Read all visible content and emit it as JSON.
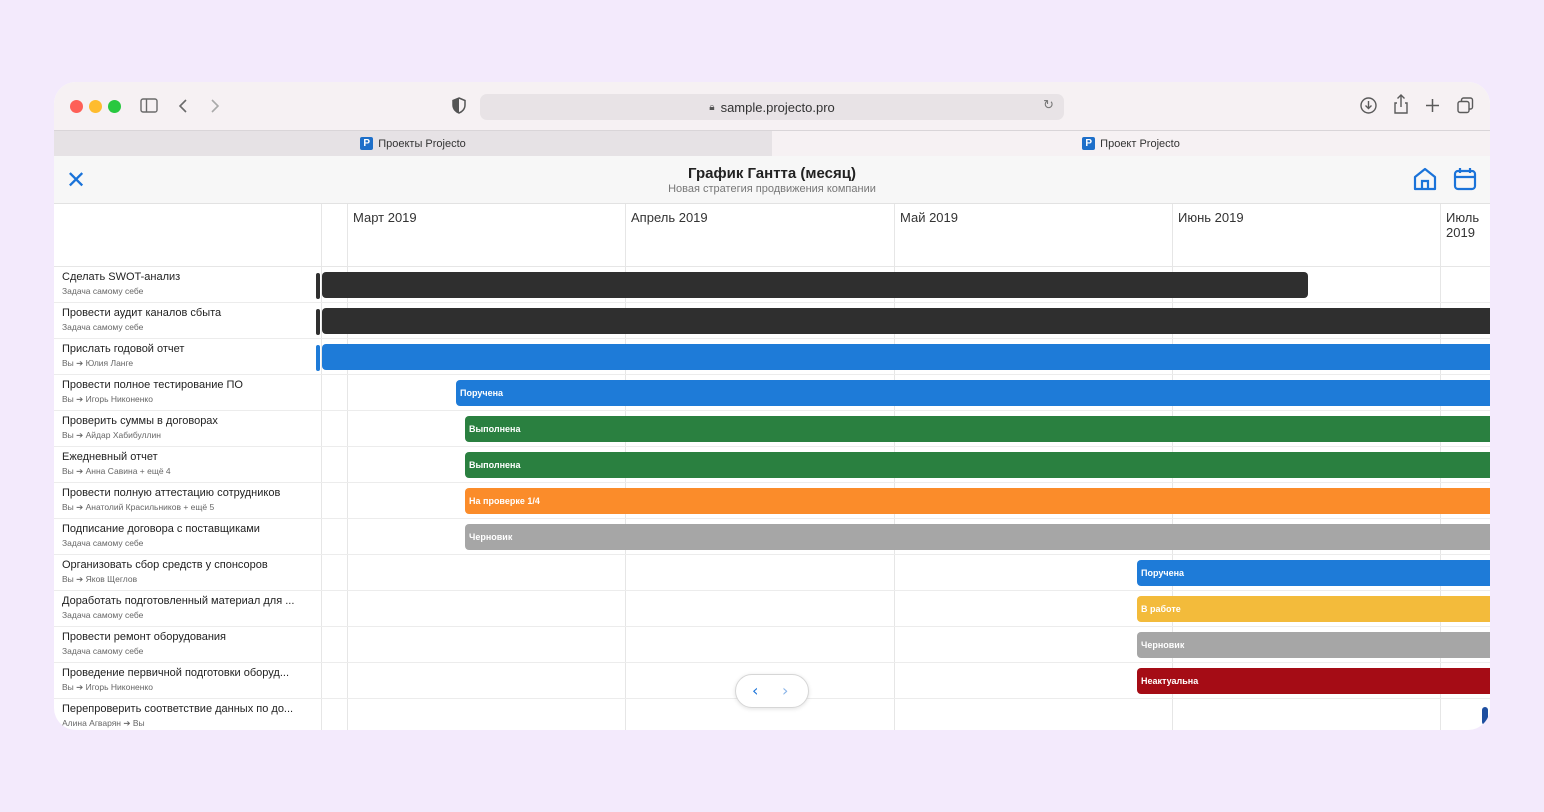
{
  "browser": {
    "url": "sample.projecto.pro",
    "tabs": [
      {
        "label": "Проекты Projecto",
        "favicon": "P"
      },
      {
        "label": "Проект Projecto",
        "favicon": "P"
      }
    ]
  },
  "header": {
    "title": "График Гантта (месяц)",
    "subtitle": "Новая стратегия продвижения компании"
  },
  "months": [
    "Март 2019",
    "Апрель 2019",
    "Май 2019",
    "Июнь 2019",
    "Июль 2019"
  ],
  "tasks": [
    {
      "name": "Сделать SWOT-анализ",
      "sub": "Задача самому себе",
      "status": "",
      "color": "#2f2f2f"
    },
    {
      "name": "Провести аудит каналов сбыта",
      "sub": "Задача самому себе",
      "status": "",
      "color": "#2f2f2f"
    },
    {
      "name": "Прислать годовой отчет",
      "sub": "Вы ➔ Юлия Ланге",
      "status": "",
      "color": "#1e7bd8"
    },
    {
      "name": "Провести полное тестирование ПО",
      "sub": "Вы ➔ Игорь Никоненко",
      "status": "Поручена",
      "color": "#1e7bd8"
    },
    {
      "name": "Проверить суммы в договорах",
      "sub": "Вы ➔ Айдар Хабибуллин",
      "status": "Выполнена",
      "color": "#2a8040"
    },
    {
      "name": "Ежедневный отчет",
      "sub": "Вы ➔ Анна Савина + ещё 4",
      "status": "Выполнена",
      "color": "#2a8040"
    },
    {
      "name": "Провести полную аттестацию сотрудников",
      "sub": "Вы ➔ Анатолий Красильников + ещё 5",
      "status": "На проверке 1/4",
      "color": "#fb8c2a"
    },
    {
      "name": "Подписание договора с поставщиками",
      "sub": "Задача самому себе",
      "status": "Черновик",
      "color": "#a6a6a6"
    },
    {
      "name": "Организовать сбор средств у спонсоров",
      "sub": "Вы ➔ Яков Щеглов",
      "status": "Поручена",
      "color": "#1e7bd8"
    },
    {
      "name": "Доработать подготовленный материал для ...",
      "sub": "Задача самому себе",
      "status": "В работе",
      "color": "#f3bb3b"
    },
    {
      "name": "Провести ремонт оборудования",
      "sub": "Задача самому себе",
      "status": "Черновик",
      "color": "#a6a6a6"
    },
    {
      "name": "Проведение первичной подготовки оборуд...",
      "sub": "Вы ➔ Игорь Никоненко",
      "status": "Неактуальна",
      "color": "#a50c15"
    },
    {
      "name": "Перепроверить соответствие данных по до...",
      "sub": "Алина Агварян ➔ Вы",
      "status": "",
      "color": "#1e4fa0"
    }
  ]
}
